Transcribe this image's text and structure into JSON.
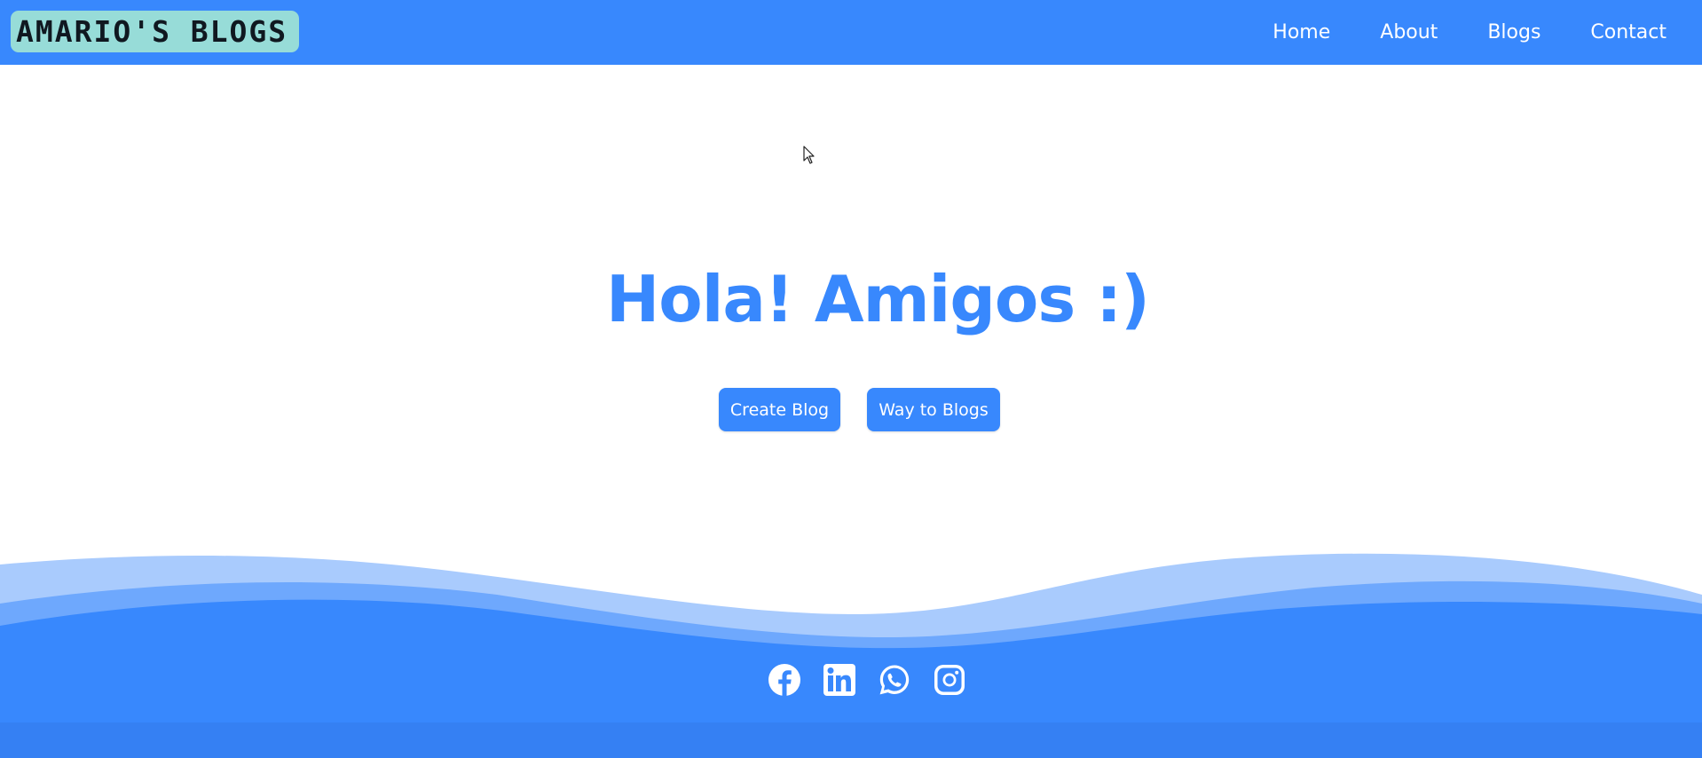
{
  "navbar": {
    "logo_text": "AMARIO'S BLOGS",
    "links": [
      {
        "label": "Home"
      },
      {
        "label": "About"
      },
      {
        "label": "Blogs"
      },
      {
        "label": "Contact"
      }
    ]
  },
  "hero": {
    "title": "Hola! Amigos :)",
    "buttons": {
      "create_label": "Create Blog",
      "way_label": "Way to Blogs"
    }
  },
  "footer": {
    "social_icons": [
      "facebook-icon",
      "linkedin-icon",
      "whatsapp-icon",
      "instagram-icon"
    ]
  },
  "colors": {
    "primary": "#3888fd",
    "logo_bg": "#97dcd8",
    "wave_light": "#a9cbfd",
    "wave_mid": "#6ea8fd"
  }
}
